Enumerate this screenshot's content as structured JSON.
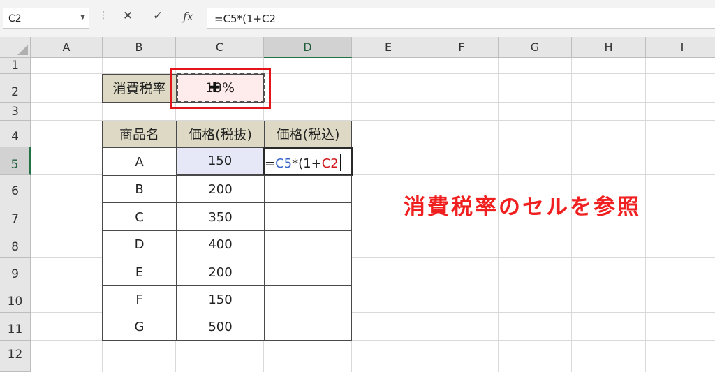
{
  "formula_bar": {
    "name_box": "C2",
    "cancel_symbol": "✕",
    "enter_symbol": "✓",
    "fx_label": "fx",
    "formula": "=C5*(1+C2"
  },
  "columns": [
    "A",
    "B",
    "C",
    "D",
    "E",
    "F",
    "G",
    "H",
    "I"
  ],
  "rows": [
    "1",
    "2",
    "3",
    "4",
    "5",
    "6",
    "7",
    "8",
    "9",
    "10",
    "11",
    "12"
  ],
  "sheet": {
    "b2_label": "消費税率",
    "c2_value": "10%",
    "table_headers": [
      "商品名",
      "価格(税抜)",
      "価格(税込)"
    ],
    "products": [
      {
        "name": "A",
        "price": "150"
      },
      {
        "name": "B",
        "price": "200"
      },
      {
        "name": "C",
        "price": "350"
      },
      {
        "name": "D",
        "price": "400"
      },
      {
        "name": "E",
        "price": "200"
      },
      {
        "name": "F",
        "price": "150"
      },
      {
        "name": "G",
        "price": "500"
      }
    ],
    "edit_formula": {
      "eq": "=",
      "ref1": "C5",
      "mid": "*(1+",
      "ref2": "C2"
    }
  },
  "annotation": "消費税率のセルを参照",
  "colors": {
    "highlight_red": "#e4141b",
    "ref_blue": "#3867c9",
    "ref_red": "#d0181c",
    "header_fill": "#ddd9c4",
    "accent_green": "#217346"
  }
}
